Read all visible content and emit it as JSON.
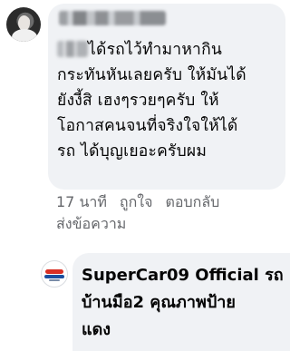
{
  "comment": {
    "author_name": "",
    "lines": [
      "ได้รถไว้ทำมาหากิน",
      "กระทันหันเลยครับ ให้มันได้",
      "ยังงี้สิ เฮงๆรวยๆครับ ให้",
      "โอกาสคนจนที่จริงใจให้ได้",
      "รถ ได้บุญเยอะครับผม"
    ],
    "time": "17 นาที",
    "like_label": "ถูกใจ",
    "reply_label": "ตอบกลับ",
    "send_message_label": "ส่งข้อความ"
  },
  "reply": {
    "lines": [
      "SuperCar09 Official รถ",
      "บ้านมือ2 คุณภาพป้าย",
      "แดง"
    ]
  },
  "colors": {
    "bubble": "#f0f2f5",
    "meta_text": "#65676b",
    "text": "#050505"
  }
}
